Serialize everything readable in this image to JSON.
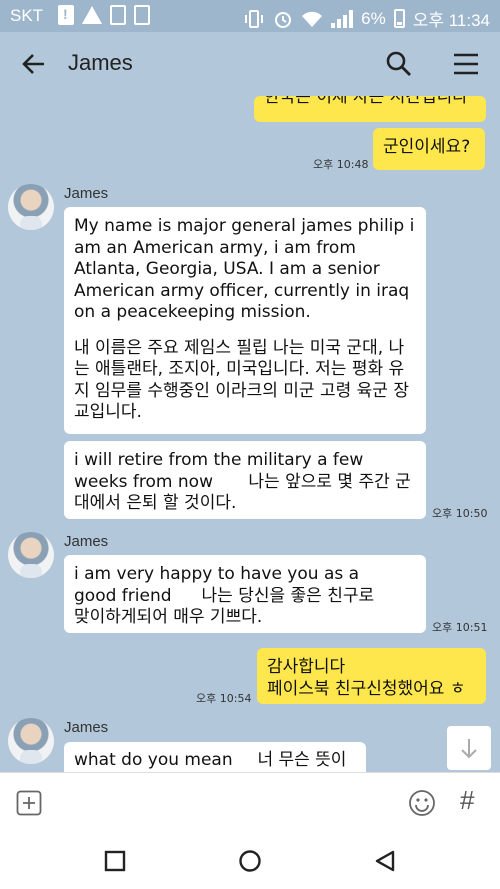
{
  "status_bar": {
    "carrier": "SKT",
    "battery": "6%",
    "time": "오후 11:34"
  },
  "header": {
    "title": "James",
    "icons": [
      "back-arrow-icon",
      "search-icon",
      "menu-icon"
    ]
  },
  "messages": {
    "m0": {
      "text": "한국은 이제 자는 시간입니다"
    },
    "m1": {
      "text": "군인이세요?",
      "time": "오후 10:48"
    },
    "g1": {
      "sender": "James",
      "p1": "My name is major general james philip i am an American army, i am from Atlanta, Georgia, USA. I am a senior American army officer, currently in iraq on a peacekeeping mission.",
      "p2": "내 이름은 주요 제임스 필립 나는 미국 군대, 나는 애틀랜타, 조지아, 미국입니다. 저는 평화 유지 임무를 수행중인 이라크의 미군 고령 육군 장교입니다.",
      "b2": "i will retire from the military a few weeks from now",
      "b2ko": "나는 앞으로 몇 주간 군대에서 은퇴 할 것이다.",
      "time": "오후 10:50"
    },
    "g2": {
      "sender": "James",
      "l1": "i am very happy to have you as a",
      "l2a": "good friend",
      "l2b": "나는 당신을 좋은 친구로",
      "l3": "맞이하게되어 매우 기쁘다.",
      "time": "오후 10:51"
    },
    "m3": {
      "l1": "감사합니다",
      "l2": "페이스북 친구신청했어요 ㅎ",
      "time": "오후 10:54"
    },
    "g3": {
      "sender": "James",
      "text_en": "what do you mean",
      "text_ko": "너 무슨 뜻이야?"
    }
  },
  "input_bar": {
    "icons": [
      "add-icon",
      "emoji-icon",
      "hashtag-icon"
    ],
    "hash": "#"
  },
  "nav_bar": {
    "icons": [
      "recent-apps-icon",
      "home-icon",
      "back-icon"
    ]
  },
  "colors": {
    "chat_bg": "#b2c7da",
    "my_bubble": "#fde74c",
    "their_bubble": "#ffffff"
  }
}
